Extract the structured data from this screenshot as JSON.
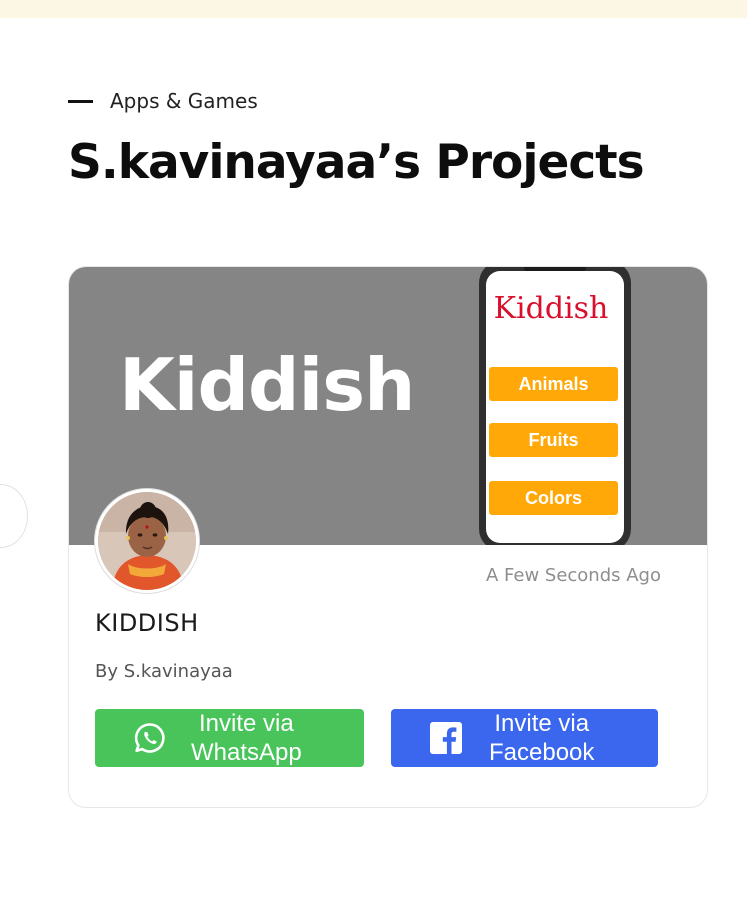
{
  "header": {
    "eyebrow": "Apps & Games",
    "title": "S.kavinayaa’s Projects"
  },
  "project_card": {
    "cover": {
      "title": "Kiddish",
      "phone_app_title": "Kiddish",
      "phone_buttons": [
        "Animals",
        "Fruits",
        "Colors"
      ]
    },
    "timestamp": "A Few Seconds Ago",
    "name": "KIDDISH",
    "author": "By S.kavinayaa",
    "whatsapp_button": {
      "line1": "Invite via",
      "line2": "WhatsApp",
      "icon": "whatsapp-icon"
    },
    "facebook_button": {
      "line1": "Invite via",
      "line2": "Facebook",
      "icon": "facebook-icon"
    }
  },
  "colors": {
    "top_strip": "#fcf6e4",
    "cover_bg": "#858585",
    "phone_button": "#ffa808",
    "phone_title": "#d8102c",
    "whatsapp": "#48c45b",
    "facebook": "#3a67ee"
  }
}
